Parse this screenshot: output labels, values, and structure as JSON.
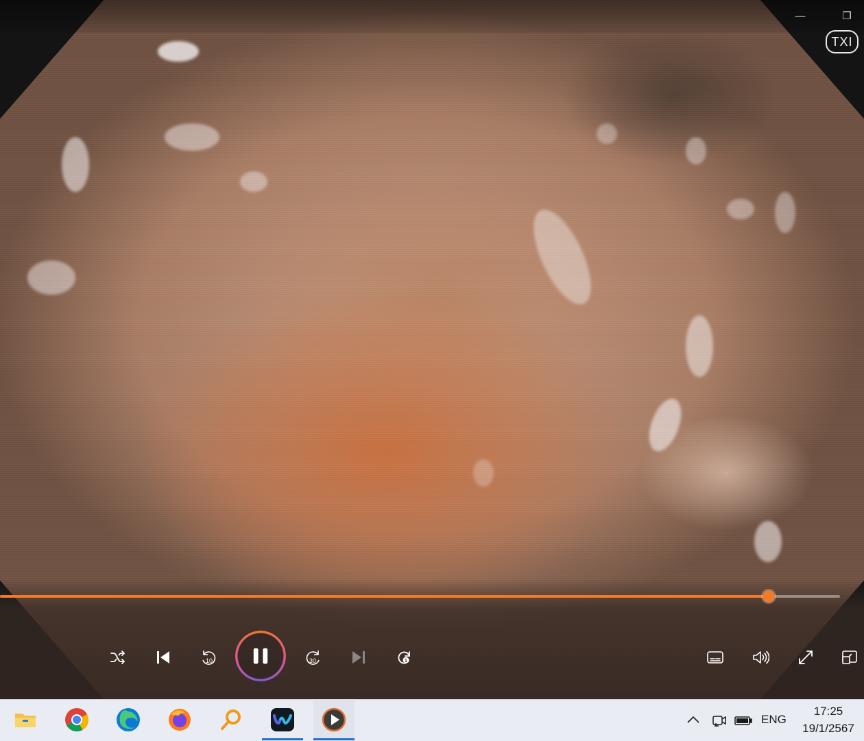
{
  "window": {
    "minimize_symbol": "—",
    "restore_symbol": "❐",
    "badge": "TXI"
  },
  "video": {
    "description_icon": "endoscopy-frame",
    "progress_fraction": 0.915
  },
  "controls": {
    "shuffle_icon": "shuffle-icon",
    "previous_icon": "previous-icon",
    "rewind_icon": "rewind-10-icon",
    "rewind_label": "10",
    "play_pause_icon": "pause-icon",
    "forward_icon": "forward-30-icon",
    "forward_label": "30",
    "next_icon": "next-icon",
    "repeat_icon": "repeat-one-icon",
    "repeat_label": "1",
    "subtitles_icon": "subtitles-icon",
    "volume_icon": "volume-icon",
    "fullscreen_icon": "fullscreen-icon",
    "miniplayer_icon": "miniplayer-icon"
  },
  "taskbar": {
    "apps": [
      "file-explorer",
      "chrome",
      "edge",
      "firefox",
      "search-magnifier",
      "webex",
      "media-player"
    ],
    "tray": {
      "chevron_icon": "chevron-up-icon",
      "meet_icon": "camera-icon",
      "battery_icon": "battery-icon",
      "language": "ENG"
    },
    "clock": {
      "time": "17:25",
      "date": "19/1/2567"
    }
  },
  "colors": {
    "accent": "#f07b28",
    "taskbar_bg": "#e9edf3",
    "active_indicator": "#1d6fd0"
  }
}
